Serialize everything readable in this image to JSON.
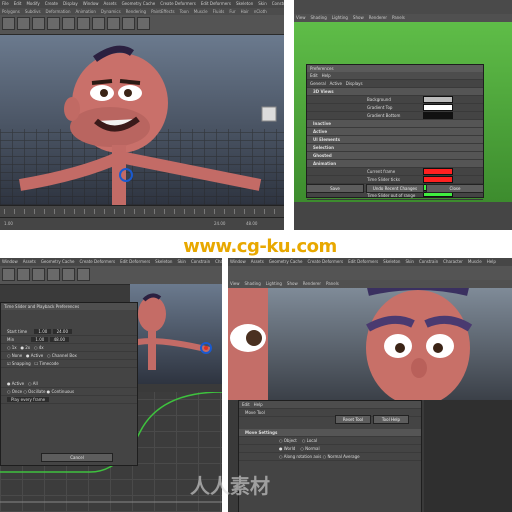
{
  "watermark": {
    "text": "www.cg-ku.com",
    "logo_text": "人人素材"
  },
  "panel1": {
    "menus": [
      "File",
      "Edit",
      "Modify",
      "Create",
      "Display",
      "Window",
      "Assets",
      "Geometry Cache",
      "Create Deformers",
      "Edit Deformers",
      "Skeleton",
      "Skin",
      "Constrain",
      "Character",
      "Muscle",
      "Help"
    ],
    "shelf_tabs": [
      "Polygons",
      "Subdivs",
      "Deformation",
      "Animation",
      "Dynamics",
      "Rendering",
      "PaintEffects",
      "Toon",
      "Muscle",
      "Fluids",
      "Fur",
      "Hair",
      "nCloth"
    ],
    "frames": [
      "1.00",
      "24.00",
      "48.00"
    ]
  },
  "panel2": {
    "menus": [
      "View",
      "Shading",
      "Lighting",
      "Show",
      "Renderer",
      "Panels"
    ],
    "dialog": {
      "title": "Preferences",
      "menus": [
        "Edit",
        "Help"
      ],
      "tabs": [
        "General",
        "Active",
        "Displays"
      ],
      "sections": [
        "3D Views",
        "Inactive",
        "Active",
        "UI Elements",
        "Selection",
        "Ghosted",
        "Animation"
      ],
      "rows": [
        {
          "label": "Background",
          "color": "#bcbcbc"
        },
        {
          "label": "Gradient Top",
          "color": "#fefefe"
        },
        {
          "label": "Gradient Bottom",
          "color": "#111111"
        },
        {
          "label": "Current frame",
          "color": "#ff2020"
        },
        {
          "label": "Time Slider ticks",
          "color": "#ff2020"
        },
        {
          "label": "Time Slider keyframes",
          "color": "#40ee40"
        },
        {
          "label": "Time Slider out of range",
          "color": "#40ee40"
        }
      ],
      "buttons": [
        "Save",
        "Undo Recent Changes",
        "Close"
      ]
    }
  },
  "panel3": {
    "menus": [
      "Window",
      "Assets",
      "Geometry Cache",
      "Create Deformers",
      "Edit Deformers",
      "Skeleton",
      "Skin",
      "Constrain",
      "Character",
      "Muscle",
      "Help"
    ],
    "dialog": {
      "title": "Time Slider and Playback Preferences",
      "fields": [
        {
          "label": "Start time",
          "value": "1.00"
        },
        {
          "label": "End time",
          "value": "24.00"
        },
        {
          "label": "Min",
          "value": "1.00"
        },
        {
          "label": "Max",
          "value": "48.00"
        }
      ],
      "height_options": [
        "1x",
        "2x",
        "4x"
      ],
      "key_ticks": [
        "None",
        "Active",
        "Channel Box"
      ],
      "options": [
        "Snapping",
        "Timecode"
      ],
      "update_view": [
        "Active",
        "All"
      ],
      "looping": [
        "Once",
        "Oscillate",
        "Continuous"
      ],
      "playback_speed": "Play every frame",
      "button": "Cancel"
    }
  },
  "panel4": {
    "menus": [
      "Window",
      "Assets",
      "Geometry Cache",
      "Create Deformers",
      "Edit Deformers",
      "Skeleton",
      "Skin",
      "Constrain",
      "Character",
      "Muscle",
      "Help"
    ],
    "view_menus": [
      "View",
      "Shading",
      "Lighting",
      "Show",
      "Renderer",
      "Panels"
    ],
    "dialog": {
      "menus": [
        "Edit",
        "Help"
      ],
      "title": "Move Tool",
      "buttons": [
        "Reset Tool",
        "Tool Help"
      ],
      "section": "Move Settings",
      "move_axis": [
        "Object",
        "Local",
        "World",
        "Normal",
        "Along rotation axis",
        "Normal Average"
      ]
    }
  }
}
